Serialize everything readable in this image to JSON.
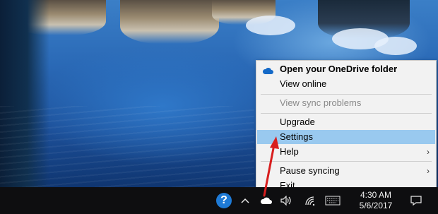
{
  "menu": {
    "items": [
      {
        "label": "Open your OneDrive folder",
        "style": "bold",
        "icon": "onedrive-cloud-icon"
      },
      {
        "label": "View online",
        "style": "normal"
      },
      {
        "label": "View sync problems",
        "style": "disabled"
      },
      {
        "label": "Upgrade",
        "style": "normal"
      },
      {
        "label": "Settings",
        "style": "highlighted"
      },
      {
        "label": "Help",
        "style": "normal",
        "submenu": true
      },
      {
        "label": "Pause syncing",
        "style": "normal",
        "submenu": true
      },
      {
        "label": "Exit",
        "style": "normal"
      }
    ],
    "submenu_glyph": "›",
    "highlight_color": "#99c9ef"
  },
  "taskbar": {
    "help_glyph": "?",
    "chevron_glyph": "^",
    "time": "4:30 AM",
    "date": "5/6/2017",
    "icons": [
      "help-icon",
      "chevron-up-icon",
      "onedrive-cloud-icon",
      "volume-icon",
      "wifi-icon",
      "keyboard-icon",
      "notification-icon"
    ]
  },
  "annotation": {
    "color": "#d81e1e",
    "icon": "red-arrow"
  }
}
